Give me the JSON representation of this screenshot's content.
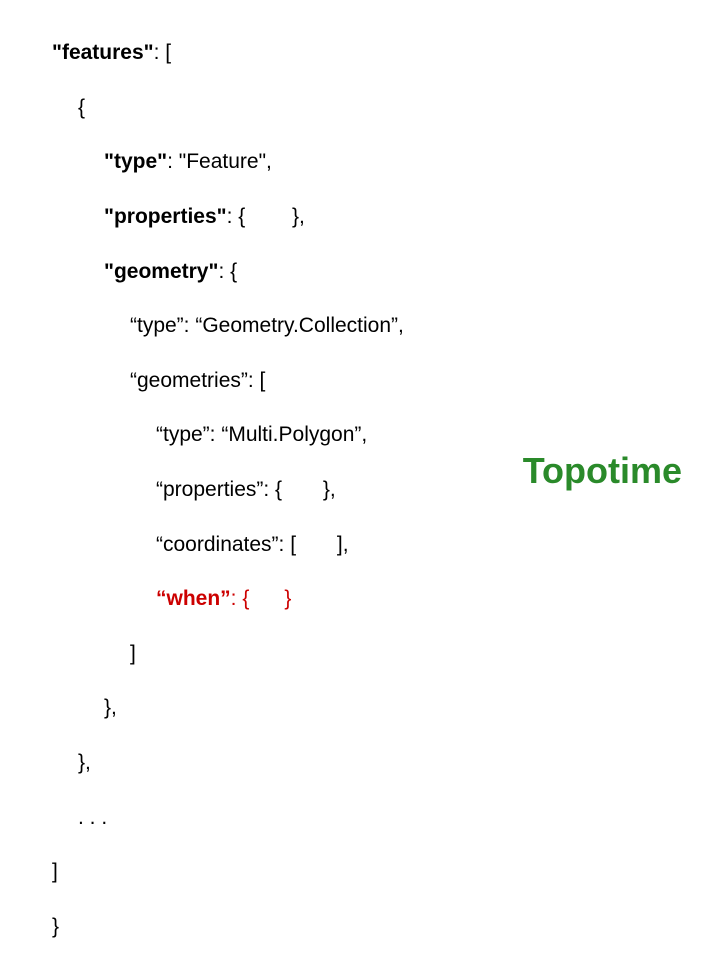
{
  "code": {
    "l1_a": "\"features\"",
    "l1_b": ": [",
    "l2": "{",
    "l3_a": "\"type\"",
    "l3_b": ": \"Feature\",",
    "l4_a": "\"properties\"",
    "l4_b": ": {        },",
    "l5_a": "\"geometry\"",
    "l5_b": ": {",
    "l6": "“type”: “Geometry.Collection”,",
    "l7": "“geometries”: [",
    "l8": "“type”: “Multi.Polygon”,",
    "l9": "“properties”: {       },",
    "l10": "“coordinates”: [       ],",
    "l11_a": "“when”",
    "l11_b": ": {      }",
    "l12": "]",
    "l13": "},",
    "l14": "},",
    "l15": ". . .",
    "l16": "]",
    "l17": "}"
  },
  "logo": "Topotime"
}
